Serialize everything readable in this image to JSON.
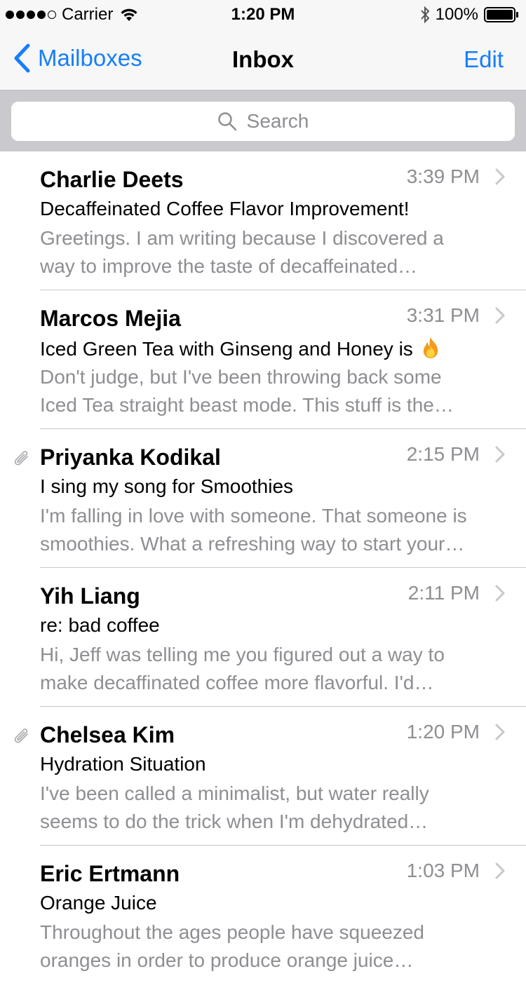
{
  "status_bar": {
    "carrier": "Carrier",
    "time": "1:20 PM",
    "battery": "100%"
  },
  "nav": {
    "back_label": "Mailboxes",
    "title": "Inbox",
    "edit_label": "Edit"
  },
  "search": {
    "placeholder": "Search"
  },
  "colors": {
    "accent": "#157efb",
    "secondary_text": "#8e8e93",
    "separator": "#c8c7cc"
  },
  "messages": [
    {
      "sender": "Charlie Deets",
      "time": "3:39 PM",
      "subject": "Decaffeinated Coffee Flavor Improvement!",
      "preview_line1": "Greetings. I am writing because I discovered a",
      "preview_line2": "way to improve the taste of decaffeinated…",
      "attachment": false
    },
    {
      "sender": "Marcos Mejia",
      "time": "3:31 PM",
      "subject": "Iced Green Tea with Ginseng and Honey is",
      "subject_icon": "fire-emoji-icon",
      "preview_line1": "Don't judge, but I've been throwing back some",
      "preview_line2": "Iced Tea straight beast mode. This stuff is the…",
      "attachment": false
    },
    {
      "sender": "Priyanka Kodikal",
      "time": "2:15 PM",
      "subject": "I sing my song for Smoothies",
      "preview_line1": "I'm falling in love with someone. That someone is",
      "preview_line2": "smoothies. What a refreshing way to start your…",
      "attachment": true
    },
    {
      "sender": "Yih Liang",
      "time": "2:11 PM",
      "subject": "re: bad coffee",
      "preview_line1": "Hi, Jeff was telling me you figured out a way to",
      "preview_line2": "make decaffinated coffee more flavorful. I'd…",
      "attachment": false
    },
    {
      "sender": "Chelsea Kim",
      "time": "1:20 PM",
      "subject": "Hydration Situation",
      "preview_line1": "I've been called a minimalist, but water really",
      "preview_line2": "seems to do the trick when I'm dehydrated…",
      "attachment": true
    },
    {
      "sender": "Eric Ertmann",
      "time": "1:03 PM",
      "subject": "Orange Juice",
      "preview_line1": "Throughout the ages people have squeezed",
      "preview_line2": "oranges in order to produce orange juice…",
      "attachment": false
    }
  ]
}
